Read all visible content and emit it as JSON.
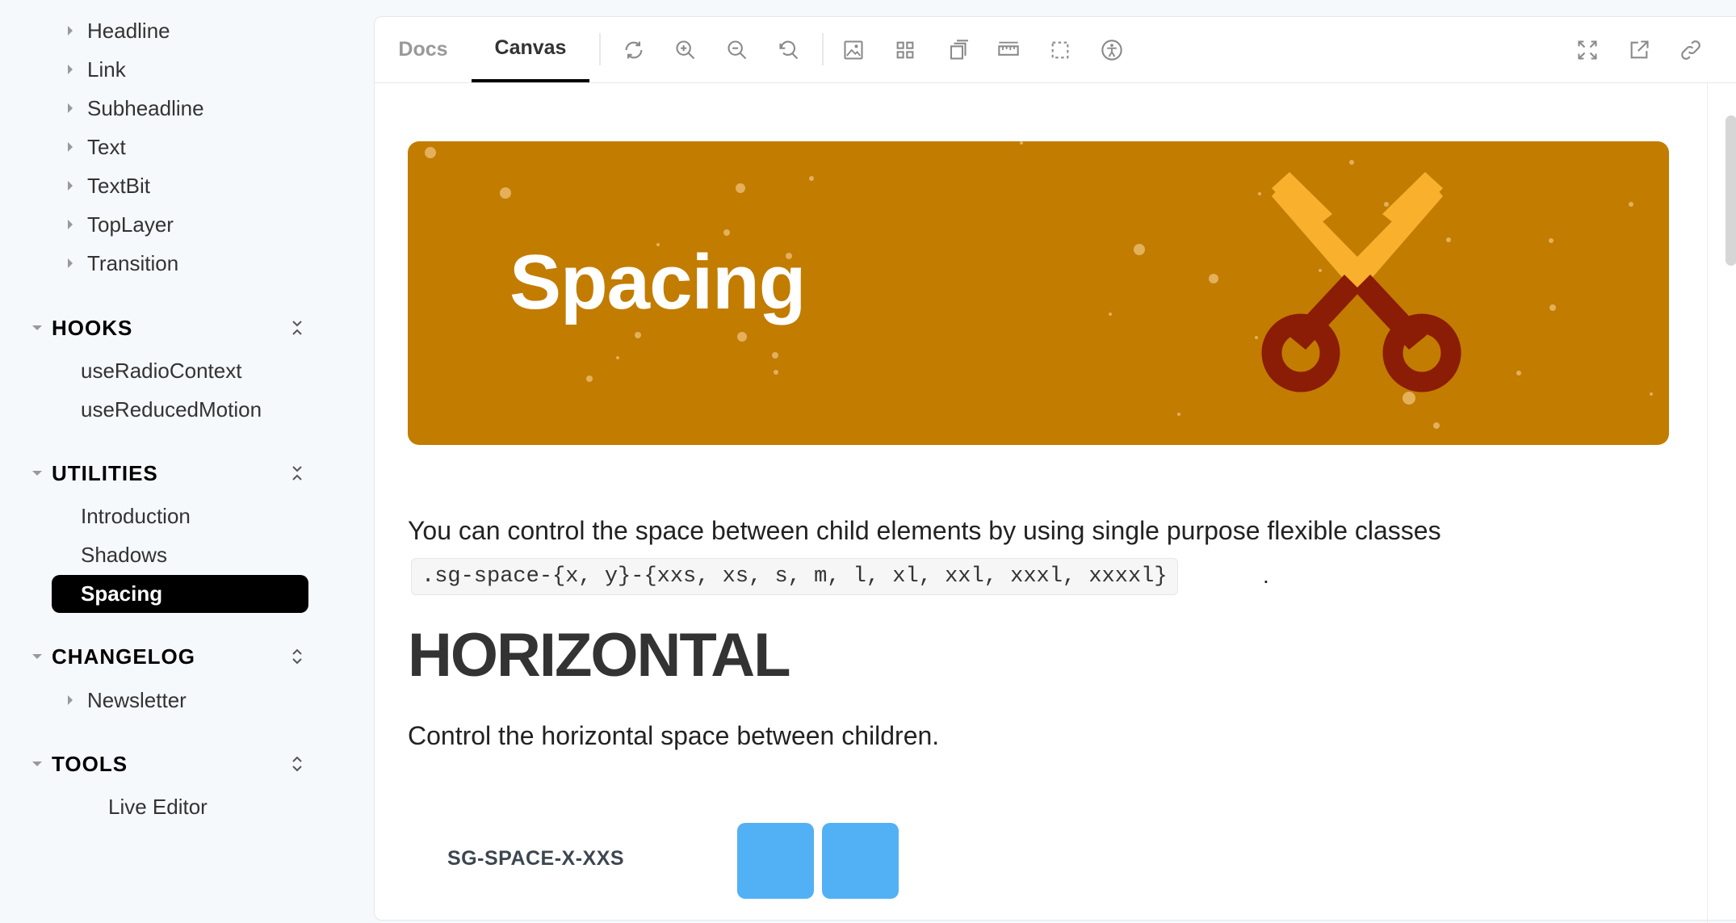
{
  "sidebar": {
    "top_items": [
      {
        "label": "Headline"
      },
      {
        "label": "Link"
      },
      {
        "label": "Subheadline"
      },
      {
        "label": "Text"
      },
      {
        "label": "TextBit"
      },
      {
        "label": "TopLayer"
      },
      {
        "label": "Transition"
      }
    ],
    "hooks": {
      "title": "HOOKS",
      "items": [
        {
          "label": "useRadioContext"
        },
        {
          "label": "useReducedMotion"
        }
      ]
    },
    "utilities": {
      "title": "UTILITIES",
      "items": [
        {
          "label": "Introduction"
        },
        {
          "label": "Shadows"
        }
      ],
      "active_item": "Spacing"
    },
    "changelog": {
      "title": "CHANGELOG",
      "items": [
        {
          "label": "Newsletter"
        }
      ]
    },
    "tools": {
      "title": "TOOLS",
      "items": [
        {
          "label": "Live Editor"
        }
      ]
    }
  },
  "toolbar": {
    "tabs": [
      {
        "label": "Docs"
      },
      {
        "label": "Canvas"
      }
    ],
    "active_tab": "Canvas",
    "icons": [
      "reload-icon",
      "zoom-in-icon",
      "zoom-out-icon",
      "reset-zoom-icon",
      "background-icon",
      "grid-icon",
      "viewport-icon",
      "measure-icon",
      "outline-icon",
      "accessibility-icon",
      "fullscreen-icon",
      "open-new-tab-icon",
      "copy-link-icon"
    ]
  },
  "content": {
    "hero_title": "Spacing",
    "intro_text": "You can control the space between child elements by using single purpose flexible classes",
    "code_sample": ".sg-space-{x, y}-{xxs, xs, s, m, l, xl, xxl, xxxl, xxxxl}",
    "code_suffix": ".",
    "heading": "HORIZONTAL",
    "description": "Control the horizontal space between children.",
    "demo_label": "SG-SPACE-X-XXS"
  },
  "colors": {
    "hero_bg": "#c27c00",
    "scissors_blade": "#f9b02c",
    "scissors_handle": "#8b1c05",
    "demo_box": "#52b1f5",
    "active_item_bg": "#000000"
  }
}
